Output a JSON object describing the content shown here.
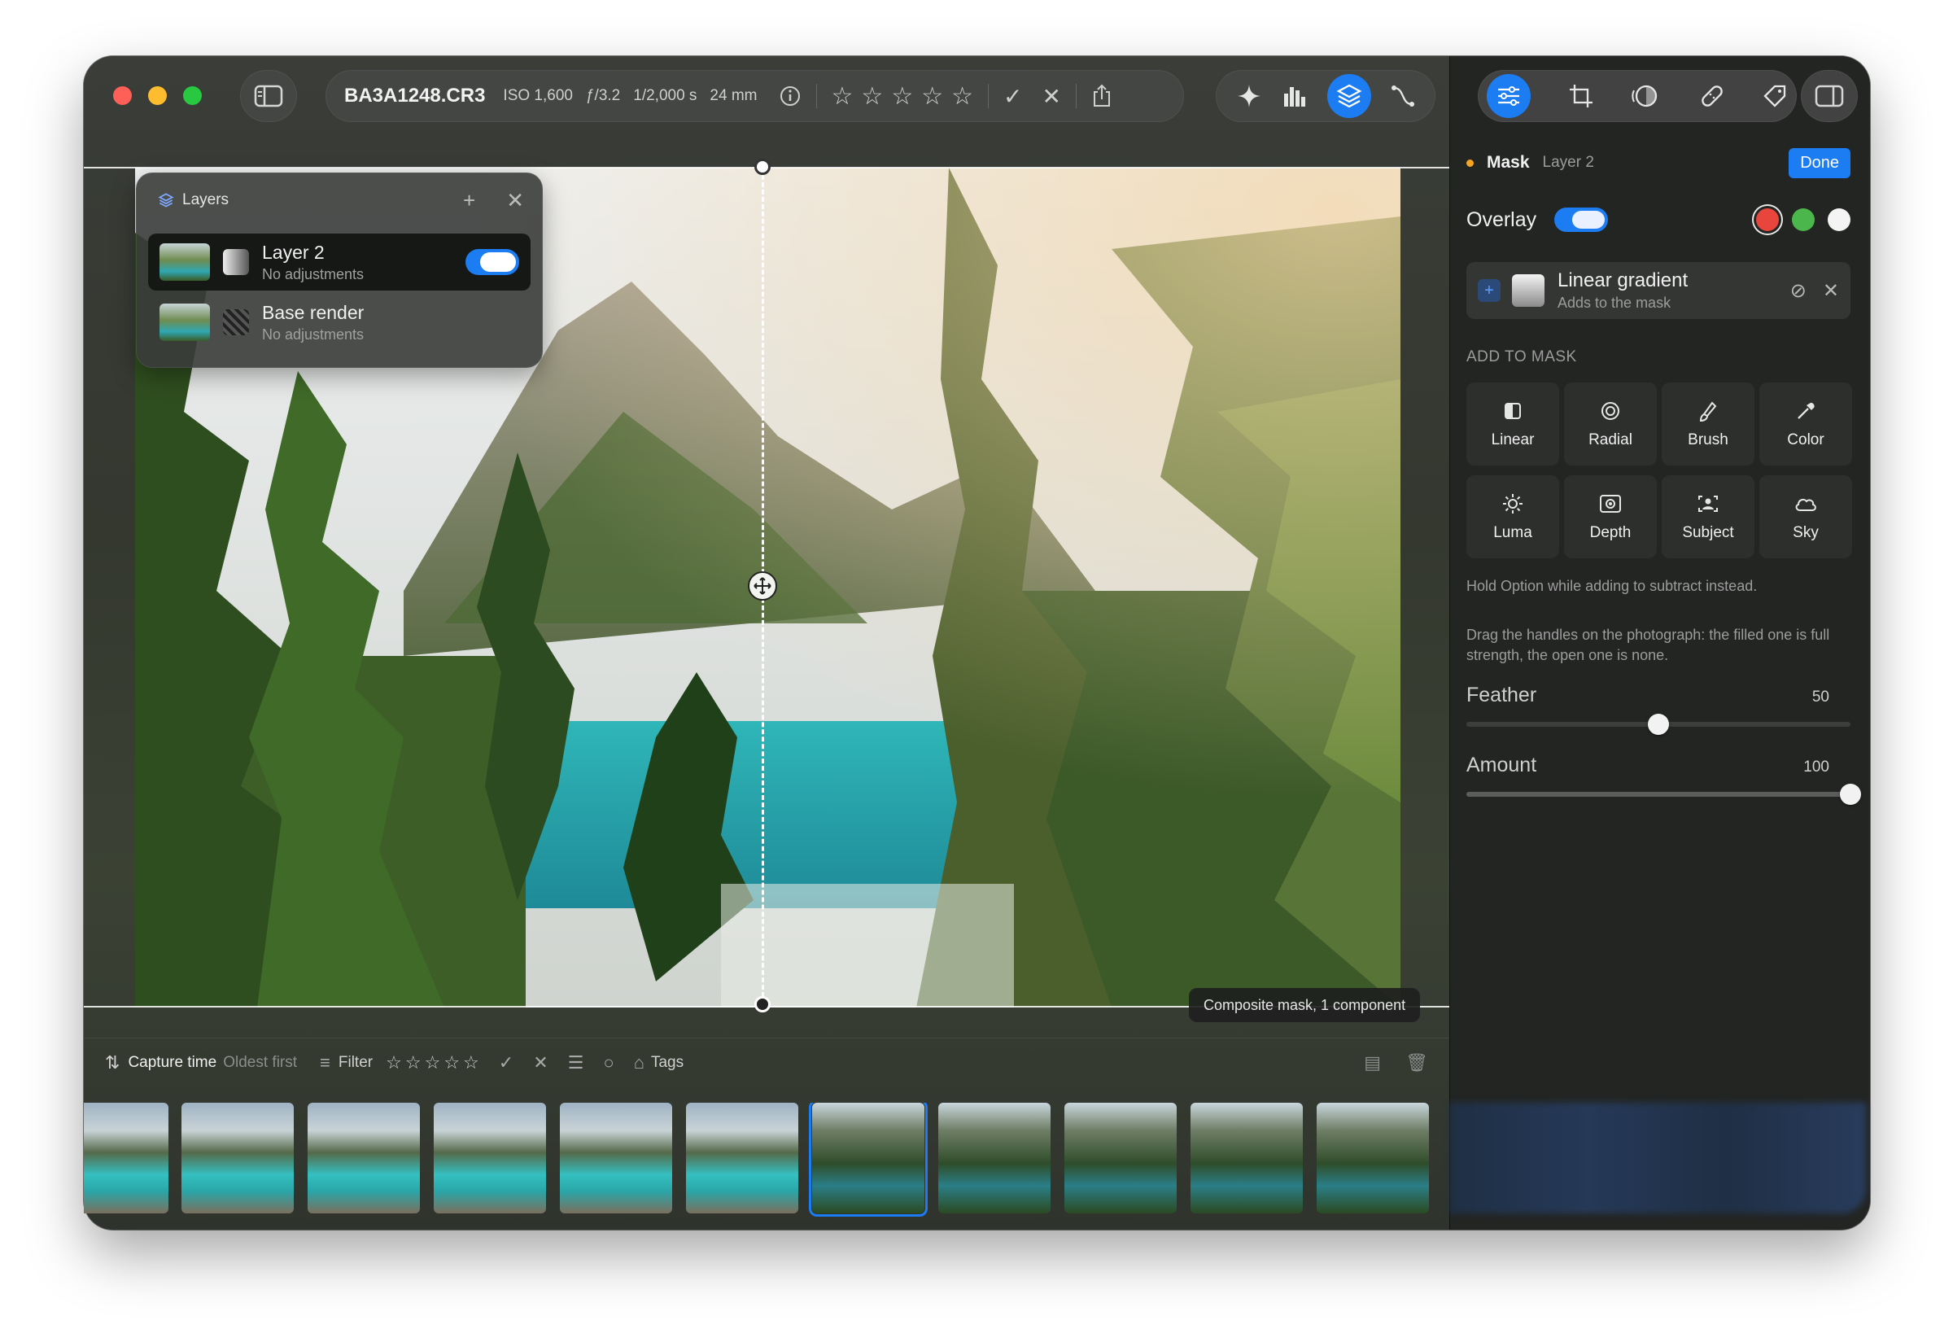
{
  "window": {
    "traffic_lights": [
      "close",
      "minimize",
      "zoom"
    ]
  },
  "toolbar": {
    "filename": "BA3A1248.CR3",
    "iso": "ISO 1,600",
    "aperture": "ƒ/3.2",
    "shutter": "1/2,000 s",
    "focal": "24 mm",
    "rating": 0,
    "rating_max": 5,
    "tools": [
      "sparkle-icon",
      "histogram-icon",
      "layers-icon",
      "curve-icon"
    ],
    "active_tool": "layers-icon"
  },
  "right_toolbar": {
    "tools": [
      "adjustments-icon",
      "crop-icon",
      "mask-icon",
      "heal-icon",
      "tag-icon"
    ],
    "active_tool": "adjustments-icon"
  },
  "layers_panel": {
    "title": "Layers",
    "layers": [
      {
        "name": "Layer 2",
        "sub": "No adjustments",
        "enabled": true
      },
      {
        "name": "Base render",
        "sub": "No adjustments"
      }
    ]
  },
  "canvas": {
    "composite_label": "Composite mask, 1 component"
  },
  "filterbar": {
    "sort_label": "Capture time",
    "sort_order": "Oldest first",
    "filter_label": "Filter",
    "tags_label": "Tags"
  },
  "filmstrip": {
    "count": 11,
    "selected_index": 6
  },
  "mask_panel": {
    "mask_label": "Mask",
    "layer_label": "Layer 2",
    "done_label": "Done",
    "overlay_label": "Overlay",
    "overlay_on": true,
    "overlay_colors": [
      "#e8453c",
      "#4bb64b",
      "#f4f4f4"
    ],
    "component": {
      "name": "Linear gradient",
      "sub": "Adds to the mask"
    },
    "add_to_mask_label": "ADD TO MASK",
    "tools": [
      {
        "label": "Linear",
        "icon": "linear-icon"
      },
      {
        "label": "Radial",
        "icon": "radial-icon"
      },
      {
        "label": "Brush",
        "icon": "brush-icon"
      },
      {
        "label": "Color",
        "icon": "eyedropper-icon"
      },
      {
        "label": "Luma",
        "icon": "sun-icon"
      },
      {
        "label": "Depth",
        "icon": "depth-icon"
      },
      {
        "label": "Subject",
        "icon": "subject-icon"
      },
      {
        "label": "Sky",
        "icon": "cloud-icon"
      }
    ],
    "hint_option": "Hold Option while adding to subtract instead.",
    "hint_drag": "Drag the handles on the photograph: the filled one is full strength, the open one is none.",
    "feather": {
      "label": "Feather",
      "value": "50",
      "fraction": 0.5
    },
    "amount": {
      "label": "Amount",
      "value": "100",
      "fraction": 1.0
    }
  }
}
